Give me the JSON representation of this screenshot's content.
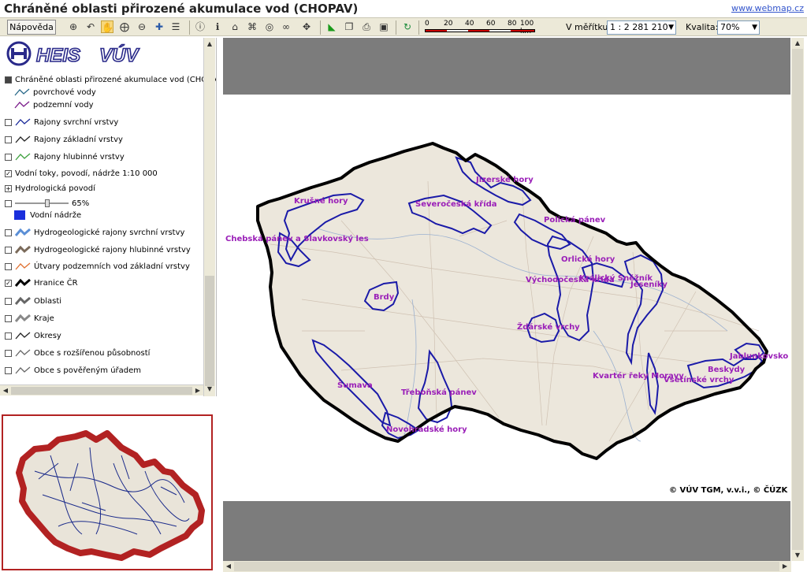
{
  "window": {
    "title": "Chráněné oblasti přirozené akumulace vod (CHOPAV)",
    "link": "www.webmap.cz"
  },
  "toolbar": {
    "help_label": "Nápověda",
    "icons": [
      "zoom-extent-icon",
      "zoom-back-icon",
      "pan-hand-icon",
      "zoom-in-icon",
      "zoom-out-icon",
      "move-icon",
      "layers-icon",
      "info-icon",
      "identify-icon",
      "home-icon",
      "query-icon",
      "binoculars-icon",
      "measure-icon",
      "flag-icon",
      "copy-icon",
      "print-icon",
      "save-icon",
      "refresh-icon"
    ],
    "scale_ticks": [
      "0",
      "20",
      "40",
      "60",
      "80",
      "100 km"
    ],
    "scale_label": "V měřítku:",
    "scale_value": "1 : 2 281 210",
    "quality_label": "Kvalita:",
    "quality_value": "70%"
  },
  "legend": {
    "items": [
      {
        "label": "Chráněné oblasti přirozené akumulace vod (CHOPA",
        "check": "filled"
      },
      {
        "label": "povrchové vody",
        "symbol": "#2a6a8a",
        "check": "none"
      },
      {
        "label": "podzemní vody",
        "symbol": "#7a1a8a",
        "check": "none"
      },
      {
        "label": "Rajony svrchní vrstvy",
        "symbol": "#1a2a9a",
        "check": "box"
      },
      {
        "label": "Rajony základní vrstvy",
        "symbol": "#222",
        "check": "box"
      },
      {
        "label": "Rajony hlubinné vrstvy",
        "symbol": "#3ca03c",
        "check": "box"
      },
      {
        "label": "Vodní toky, povodí, nádrže 1:10 000",
        "check": "checked"
      },
      {
        "label": "Hydrologická povodí",
        "check": "boxplus"
      },
      {
        "label": "65%",
        "check": "box",
        "slider": true
      },
      {
        "label": "Vodní nádrže",
        "check": "none",
        "fill": "#1a2fdc"
      },
      {
        "label": "Hydrogeologické rajony svrchní vrstvy",
        "symbol": "#5b8fd6",
        "check": "box",
        "thick": true
      },
      {
        "label": "Hydrogeologické rajony hlubinné vrstvy",
        "symbol": "#7a6a5a",
        "check": "box",
        "thick": true
      },
      {
        "label": "Útvary podzemních vod základní vrstvy",
        "symbol": "#e07030",
        "check": "box"
      },
      {
        "label": "Hranice ČR",
        "symbol": "#000",
        "check": "checked",
        "thick": true
      },
      {
        "label": "Oblasti",
        "symbol": "#666",
        "check": "box",
        "thick": true
      },
      {
        "label": "Kraje",
        "symbol": "#888",
        "check": "box",
        "thick": true
      },
      {
        "label": "Okresy",
        "symbol": "#222",
        "check": "box"
      },
      {
        "label": "Obce s rozšířenou působností",
        "symbol": "#666",
        "check": "box"
      },
      {
        "label": "Obce s pověřeným úřadem",
        "symbol": "#666",
        "check": "box"
      },
      {
        "label": "Obce",
        "symbol": "#999",
        "check": "box"
      }
    ]
  },
  "map": {
    "labels": [
      "Jizerské hory",
      "Krušné hory",
      "Severočeská křída",
      "Polická pánev",
      "Chebská pánev a Slavkovský les",
      "Orlické hory",
      "Východočeská křída",
      "Králický Sněžník",
      "Jeseníky",
      "Brdy",
      "Žďárské vrchy",
      "Jablunkovsko",
      "Beskydy",
      "Vsetínské vrchy",
      "Kvartér řeky Moravy",
      "Šumava",
      "Třeboňská pánev",
      "Novohradské hory"
    ],
    "copyright": "© VÚV TGM, v.v.i., © ČÚZK"
  },
  "colors": {
    "border_cr": "#000000",
    "chopav": "#1a1aa8",
    "label": "#9a1fb8",
    "overview_border": "#b22222"
  }
}
